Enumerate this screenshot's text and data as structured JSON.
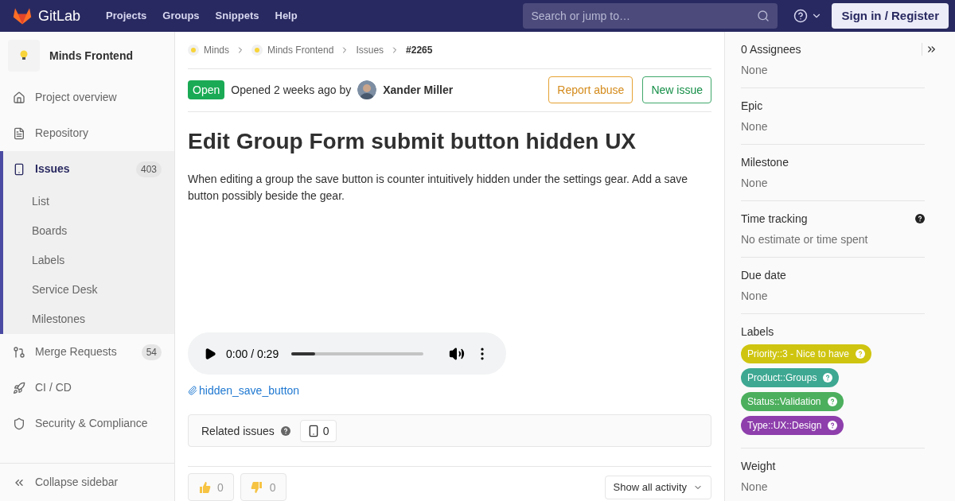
{
  "navbar": {
    "brand": "GitLab",
    "links": [
      "Projects",
      "Groups",
      "Snippets",
      "Help"
    ],
    "search": {
      "placeholder": "Search or jump to…"
    },
    "sign_in": "Sign in / Register"
  },
  "sidebar": {
    "project": "Minds Frontend",
    "items": [
      {
        "label": "Project overview",
        "selected": false
      },
      {
        "label": "Repository",
        "selected": false
      },
      {
        "label": "Issues",
        "count": "403",
        "selected": true,
        "children": [
          {
            "label": "List",
            "selected": false
          },
          {
            "label": "Boards",
            "selected": false
          },
          {
            "label": "Labels",
            "selected": false
          },
          {
            "label": "Service Desk",
            "selected": false
          },
          {
            "label": "Milestones",
            "selected": false
          }
        ]
      },
      {
        "label": "Merge Requests",
        "count": "54",
        "selected": false
      },
      {
        "label": "CI / CD",
        "selected": false
      },
      {
        "label": "Security & Compliance",
        "selected": false
      }
    ],
    "collapse": "Collapse sidebar"
  },
  "breadcrumbs": [
    "Minds",
    "Minds Frontend",
    "Issues",
    "#2265"
  ],
  "issue": {
    "status": "Open",
    "opened": "Opened 2 weeks ago by",
    "author": "Xander Miller",
    "actions": [
      {
        "label": "Report abuse",
        "kind": "warning"
      },
      {
        "label": "New issue",
        "kind": "success"
      }
    ],
    "title": "Edit Group Form submit button hidden UX",
    "description": "When editing a group the save button is counter intuitively hidden under the settings gear. Add a save button possibly beside the gear.",
    "audio": {
      "time": "0:00 / 0:29",
      "level": 0.18
    },
    "attachment": "hidden_save_button",
    "related": {
      "label": "Related issues",
      "count": "0"
    },
    "reactions": [
      {
        "kind": "up",
        "count": "0"
      },
      {
        "kind": "down",
        "count": "0"
      }
    ],
    "activity": "Show all activity"
  },
  "right_sidebar": {
    "sections": [
      {
        "title": "0 Assignees",
        "value": "None"
      },
      {
        "title": "Epic",
        "value": "None"
      },
      {
        "title": "Milestone",
        "value": "None"
      },
      {
        "title": "Time tracking",
        "value": "No estimate or time spent"
      },
      {
        "title": "Due date",
        "value": "None"
      },
      {
        "title": "Labels",
        "labels": [
          {
            "text": "Priority::3 - Nice to have",
            "color": "#cfc510"
          },
          {
            "text": "Product::Groups",
            "color": "#3ea892"
          },
          {
            "text": "Status::Validation",
            "color": "#4caf5d"
          },
          {
            "text": "Type::UX::Design",
            "color": "#8e3fac"
          }
        ]
      },
      {
        "title": "Weight",
        "value": "None"
      }
    ]
  }
}
